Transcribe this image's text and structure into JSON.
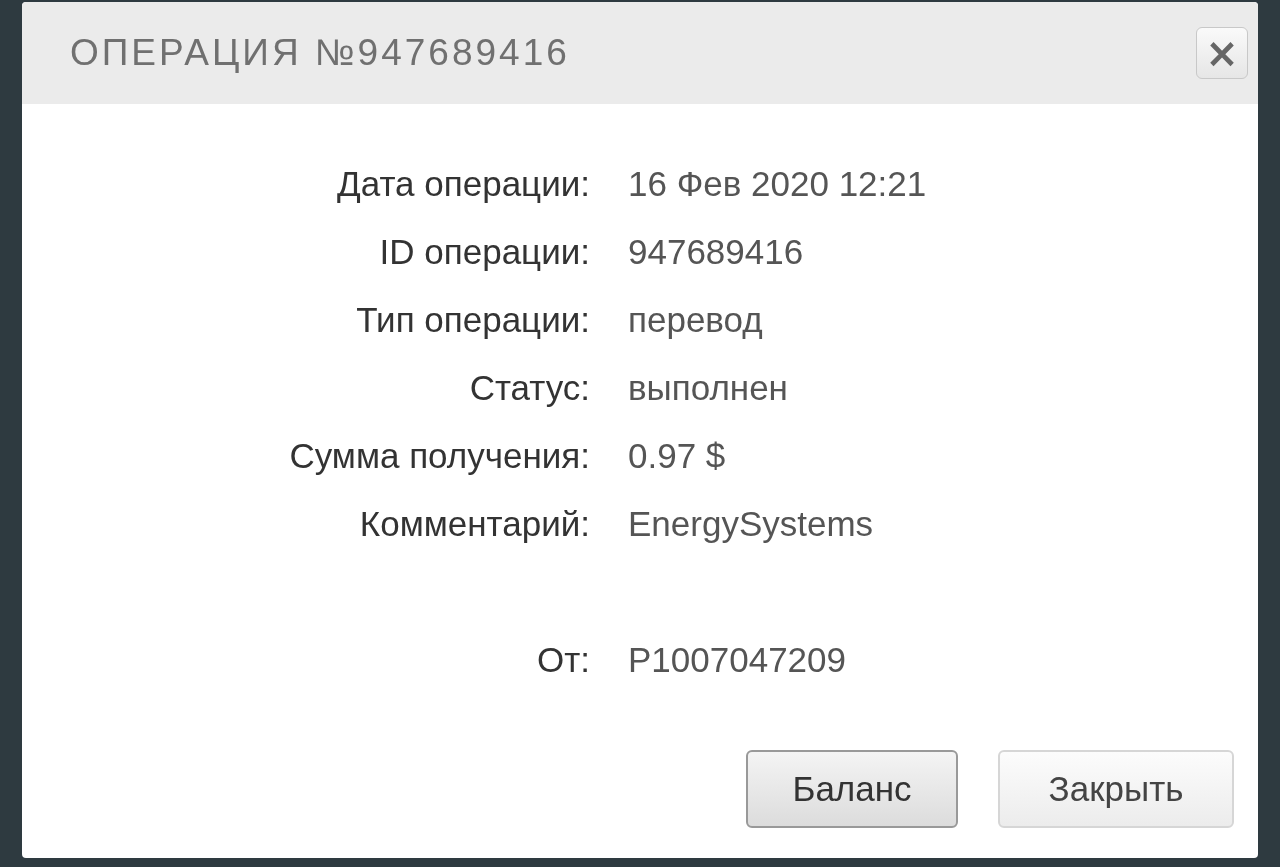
{
  "dialog": {
    "title": "ОПЕРАЦИЯ №947689416",
    "close_label": "×"
  },
  "fields": [
    {
      "label": "Дата операции:",
      "value": "16 Фев 2020 12:21"
    },
    {
      "label": "ID операции:",
      "value": "947689416"
    },
    {
      "label": "Тип операции:",
      "value": "перевод"
    },
    {
      "label": "Статус:",
      "value": "выполнен"
    },
    {
      "label": "Сумма получения:",
      "value": "0.97 $"
    },
    {
      "label": "Комментарий:",
      "value": "EnergySystems"
    }
  ],
  "sender": {
    "label": "От:",
    "value": "P1007047209"
  },
  "buttons": [
    {
      "label": "Баланс",
      "focused": true
    },
    {
      "label": "Закрыть",
      "focused": false
    }
  ]
}
